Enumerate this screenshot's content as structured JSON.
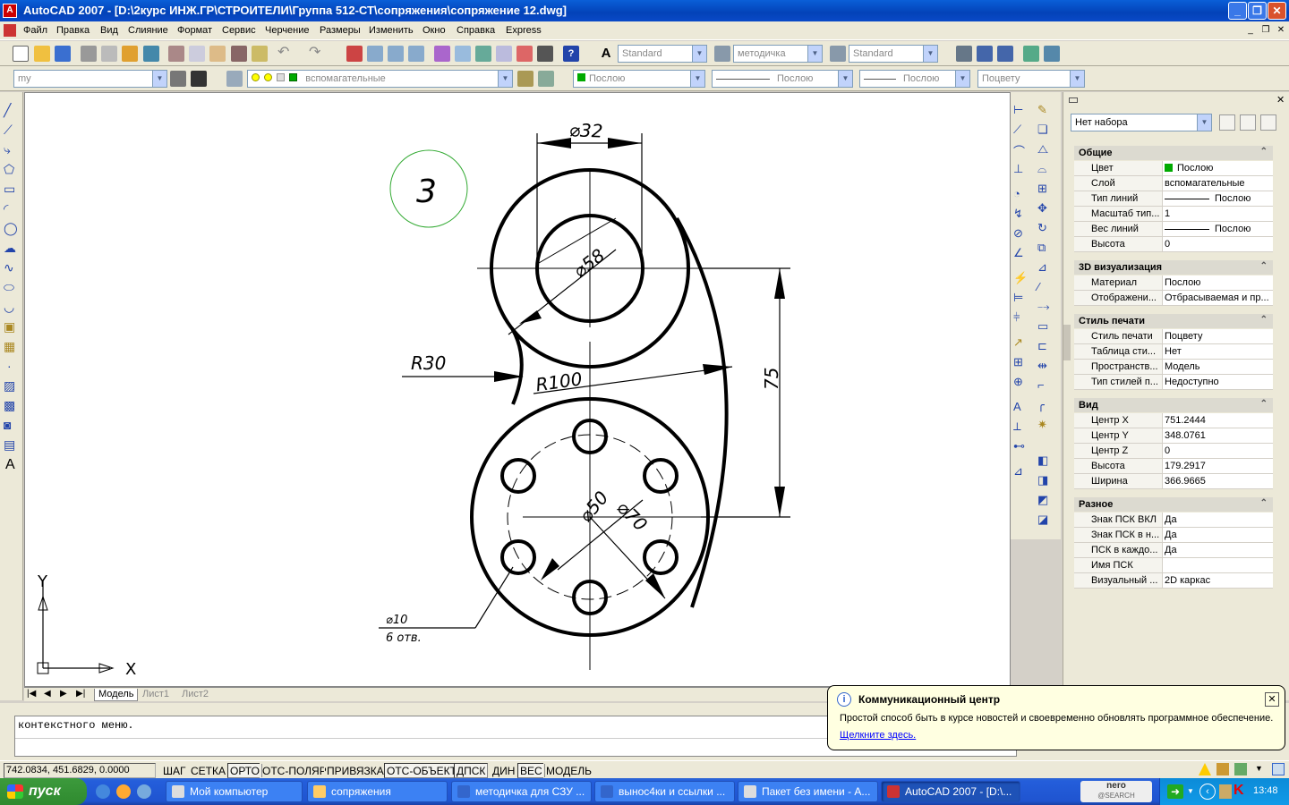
{
  "window": {
    "title": "AutoCAD 2007 - [D:\\2курс ИНЖ.ГР\\СТРОИТЕЛИ\\Группа 512-СТ\\сопряжения\\сопряжение 12.dwg]"
  },
  "menu": [
    "Файл",
    "Правка",
    "Вид",
    "Слияние",
    "Формат",
    "Сервис",
    "Черчение",
    "Размеры",
    "Изменить",
    "Окно",
    "Справка",
    "Express"
  ],
  "toolbar1": {
    "text_style": "Standard",
    "dim_style": "методичка",
    "table_style": "Standard"
  },
  "toolbar2": {
    "workspace": "my",
    "layer": "вспомагательные",
    "color": "Послою",
    "linetype": "Послою",
    "lineweight": "Послою",
    "plotstyle": "Поцвету"
  },
  "drawing": {
    "label_number": "3",
    "dim_d32": "⌀32",
    "dim_d58": "⌀58",
    "dim_r30": "R30",
    "dim_r100": "R100",
    "dim_75": "75",
    "dim_d50": "⌀50",
    "dim_d70": "⌀70",
    "dim_d10": "⌀10",
    "dim_holes": "6 отв.",
    "axis_x": "X",
    "axis_y": "Y"
  },
  "tabs": [
    {
      "label": "Модель",
      "active": true
    },
    {
      "label": "Лист1",
      "active": false
    },
    {
      "label": "Лист2",
      "active": false
    }
  ],
  "properties": {
    "selection": "Нет набора",
    "sections": [
      {
        "title": "Общие",
        "rows": [
          {
            "k": "Цвет",
            "v": "Послою",
            "swatch": "#00aa00"
          },
          {
            "k": "Слой",
            "v": "вспомагательные"
          },
          {
            "k": "Тип линий",
            "v": "Послою",
            "line": true
          },
          {
            "k": "Масштаб тип...",
            "v": "1"
          },
          {
            "k": "Вес линий",
            "v": "Послою",
            "line": true
          },
          {
            "k": "Высота",
            "v": "0"
          }
        ]
      },
      {
        "title": "3D визуализация",
        "rows": [
          {
            "k": "Материал",
            "v": "Послою"
          },
          {
            "k": "Отображени...",
            "v": "Отбрасываемая и пр..."
          }
        ]
      },
      {
        "title": "Стиль печати",
        "rows": [
          {
            "k": "Стиль печати",
            "v": "Поцвету"
          },
          {
            "k": "Таблица сти...",
            "v": "Нет"
          },
          {
            "k": "Пространств...",
            "v": "Модель"
          },
          {
            "k": "Тип стилей п...",
            "v": "Недоступно"
          }
        ]
      },
      {
        "title": "Вид",
        "rows": [
          {
            "k": "Центр X",
            "v": "751.2444"
          },
          {
            "k": "Центр Y",
            "v": "348.0761"
          },
          {
            "k": "Центр Z",
            "v": "0"
          },
          {
            "k": "Высота",
            "v": "179.2917"
          },
          {
            "k": "Ширина",
            "v": "366.9665"
          }
        ]
      },
      {
        "title": "Разное",
        "rows": [
          {
            "k": "Знак ПСК ВКЛ",
            "v": "Да"
          },
          {
            "k": "Знак ПСК в н...",
            "v": "Да"
          },
          {
            "k": "ПСК в каждо...",
            "v": "Да"
          },
          {
            "k": "Имя ПСК",
            "v": ""
          },
          {
            "k": "Визуальный ...",
            "v": "2D каркас"
          }
        ]
      }
    ]
  },
  "command": {
    "text": "контекстного меню."
  },
  "balloon": {
    "title": "Коммуникационный центр",
    "body": "Простой способ быть в курсе новостей и своевременно обновлять программное обеспечение.",
    "link": "Щелкните здесь."
  },
  "status": {
    "coords": "742.0834, 451.6829, 0.0000",
    "buttons": [
      {
        "l": "ШАГ",
        "on": false
      },
      {
        "l": "СЕТКА",
        "on": false
      },
      {
        "l": "ОРТО",
        "on": true
      },
      {
        "l": "ОТС-ПОЛЯР",
        "on": false
      },
      {
        "l": "ПРИВЯЗКА",
        "on": false
      },
      {
        "l": "ОТС-ОБЪЕКТ",
        "on": true
      },
      {
        "l": "ДПСК",
        "on": true
      },
      {
        "l": "ДИН",
        "on": false
      },
      {
        "l": "ВЕС",
        "on": true
      },
      {
        "l": "МОДЕЛЬ",
        "on": false
      }
    ]
  },
  "taskbar": {
    "start": "пуск",
    "tasks": [
      "Мой компьютер",
      "сопряжения",
      "методичка для СЗУ ...",
      "вынос4ки и ссылки ...",
      "Пакет без имени - А...",
      "AutoCAD 2007 - [D:\\..."
    ],
    "nero": "nero",
    "nero_sub": "@SEARCH",
    "clock": "13:48"
  }
}
